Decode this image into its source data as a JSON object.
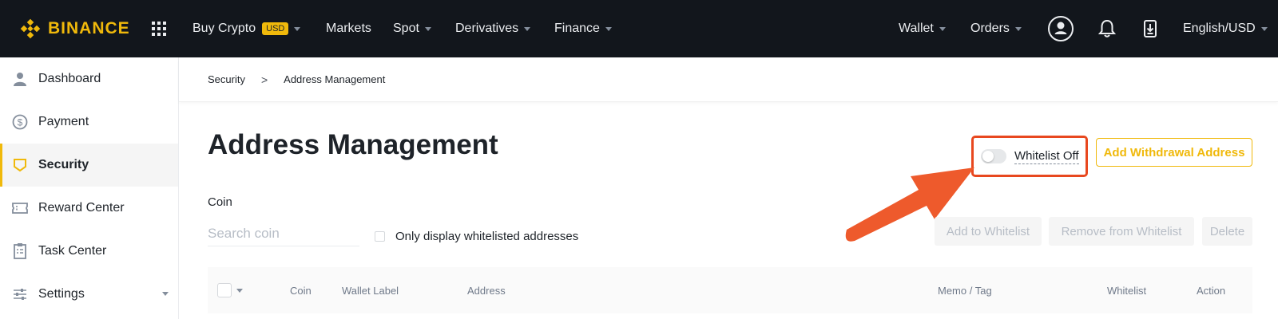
{
  "colors": {
    "brand": "#f0b90b",
    "topbar": "#12161c",
    "highlight": "#e8481f"
  },
  "topbar": {
    "logo": "BINANCE",
    "nav": [
      {
        "label": "Buy Crypto",
        "badge": "USD",
        "has_caret": true
      },
      {
        "label": "Markets",
        "has_caret": false
      },
      {
        "label": "Spot",
        "has_caret": true
      },
      {
        "label": "Derivatives",
        "has_caret": true
      },
      {
        "label": "Finance",
        "has_caret": true
      }
    ],
    "right": [
      {
        "label": "Wallet",
        "has_caret": true
      },
      {
        "label": "Orders",
        "has_caret": true
      }
    ],
    "icons": [
      "apps-grid-icon",
      "user-avatar-icon",
      "bell-icon",
      "download-icon"
    ],
    "language": "English/USD"
  },
  "sidebar": {
    "items": [
      {
        "label": "Dashboard",
        "icon": "user-icon"
      },
      {
        "label": "Payment",
        "icon": "dollar-circle-icon"
      },
      {
        "label": "Security",
        "icon": "shield-icon",
        "active": true
      },
      {
        "label": "Reward Center",
        "icon": "ticket-icon"
      },
      {
        "label": "Task Center",
        "icon": "clipboard-icon"
      },
      {
        "label": "Settings",
        "icon": "sliders-icon",
        "has_caret": true
      }
    ]
  },
  "breadcrumb": {
    "parent": "Security",
    "separator": ">",
    "current": "Address Management"
  },
  "main": {
    "title": "Address Management",
    "whitelist_toggle": {
      "label": "Whitelist Off",
      "on": false
    },
    "add_button": "Add Withdrawal Address",
    "coin_label": "Coin",
    "search_placeholder": "Search coin",
    "only_whitelisted_label": "Only display whitelisted addresses",
    "actions": {
      "add_to_whitelist": "Add to Whitelist",
      "remove_from_whitelist": "Remove from Whitelist",
      "delete": "Delete"
    },
    "table_columns": [
      "Coin",
      "Wallet Label",
      "Address",
      "Memo / Tag",
      "Whitelist",
      "Action"
    ]
  }
}
